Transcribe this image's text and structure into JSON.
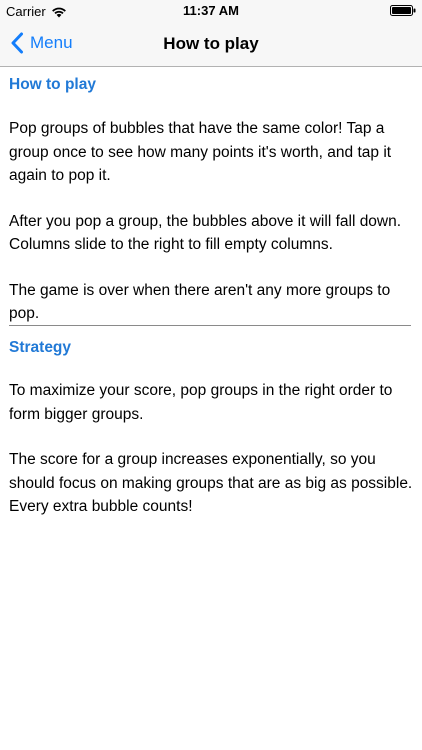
{
  "status_bar": {
    "carrier": "Carrier",
    "time": "11:37 AM"
  },
  "nav": {
    "back_label": "Menu",
    "title": "How to play"
  },
  "sections": [
    {
      "heading": "How to play",
      "paragraphs": [
        "Pop groups of bubbles that have the same color! Tap a group once to see how many points it's worth, and tap it again to pop it.",
        "After you pop a group, the bubbles above it will fall down. Columns slide to the right to fill empty columns.",
        "The game is over when there aren't any more groups to pop."
      ]
    },
    {
      "heading": "Strategy",
      "paragraphs": [
        "To maximize your score, pop groups in the right order to form bigger groups.",
        "The score for a group increases exponentially, so you should focus on making groups that are as big as possible. Every extra bubble counts!"
      ]
    }
  ],
  "colors": {
    "accent": "#147efb",
    "heading": "#2179d6",
    "bar": "#f7f7f7"
  }
}
